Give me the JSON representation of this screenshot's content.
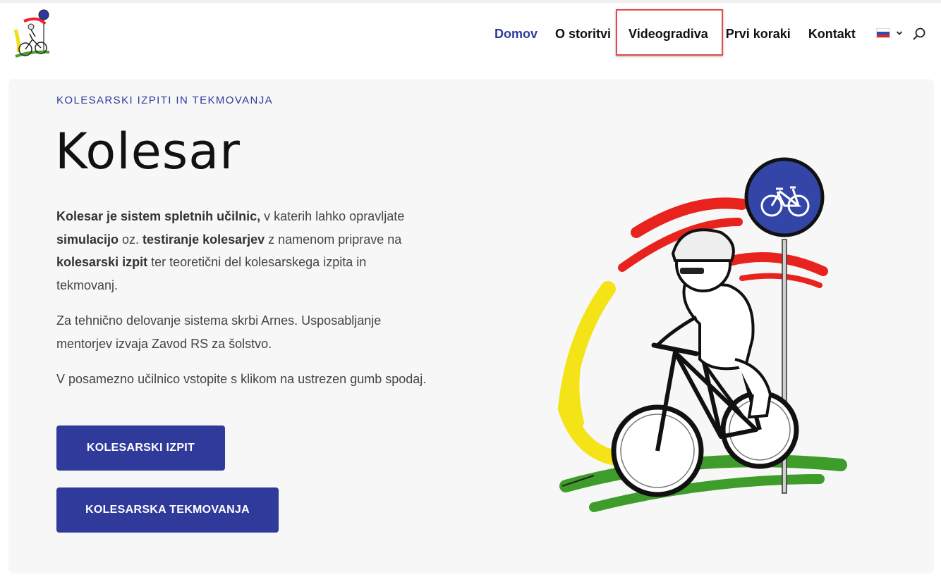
{
  "header": {
    "nav": [
      {
        "label": "Domov",
        "active": true
      },
      {
        "label": "O storitvi",
        "active": false
      },
      {
        "label": "Videogradiva",
        "active": false,
        "highlighted": true
      },
      {
        "label": "Prvi koraki",
        "active": false
      },
      {
        "label": "Kontakt",
        "active": false
      }
    ],
    "language": {
      "icon": "slovenian-flag-icon",
      "dropdown_icon": "chevron-down-icon"
    },
    "search_icon": "search-icon",
    "highlight_color": "#e24b4b"
  },
  "hero": {
    "eyebrow": "KOLESARSKI IZPITI IN TEKMOVANJA",
    "title": "Kolesar",
    "p1": {
      "b1": "Kolesar je sistem spletnih učilnic,",
      "t1": " v katerih lahko opravljate ",
      "b2": "simulacijo",
      "t2": " oz. ",
      "b3": "testiranje kolesarjev",
      "t3": " z namenom priprave na ",
      "b4": "kolesarski izpit",
      "t4": " ter teoretični del kolesarskega izpita in tekmovanj."
    },
    "p2": "Za tehnično delovanje sistema skrbi Arnes. Usposabljanje mentorjev izvaja Zavod RS za šolstvo.",
    "p3": "V posamezno učilnico vstopite s klikom na ustrezen gumb spodaj.",
    "buttons": {
      "exam": "KOLESARSKI IZPIT",
      "competitions": "KOLESARSKA TEKMOVANJA"
    }
  },
  "colors": {
    "accent": "#2f3a9b",
    "hero_bg": "#f7f7f7"
  }
}
